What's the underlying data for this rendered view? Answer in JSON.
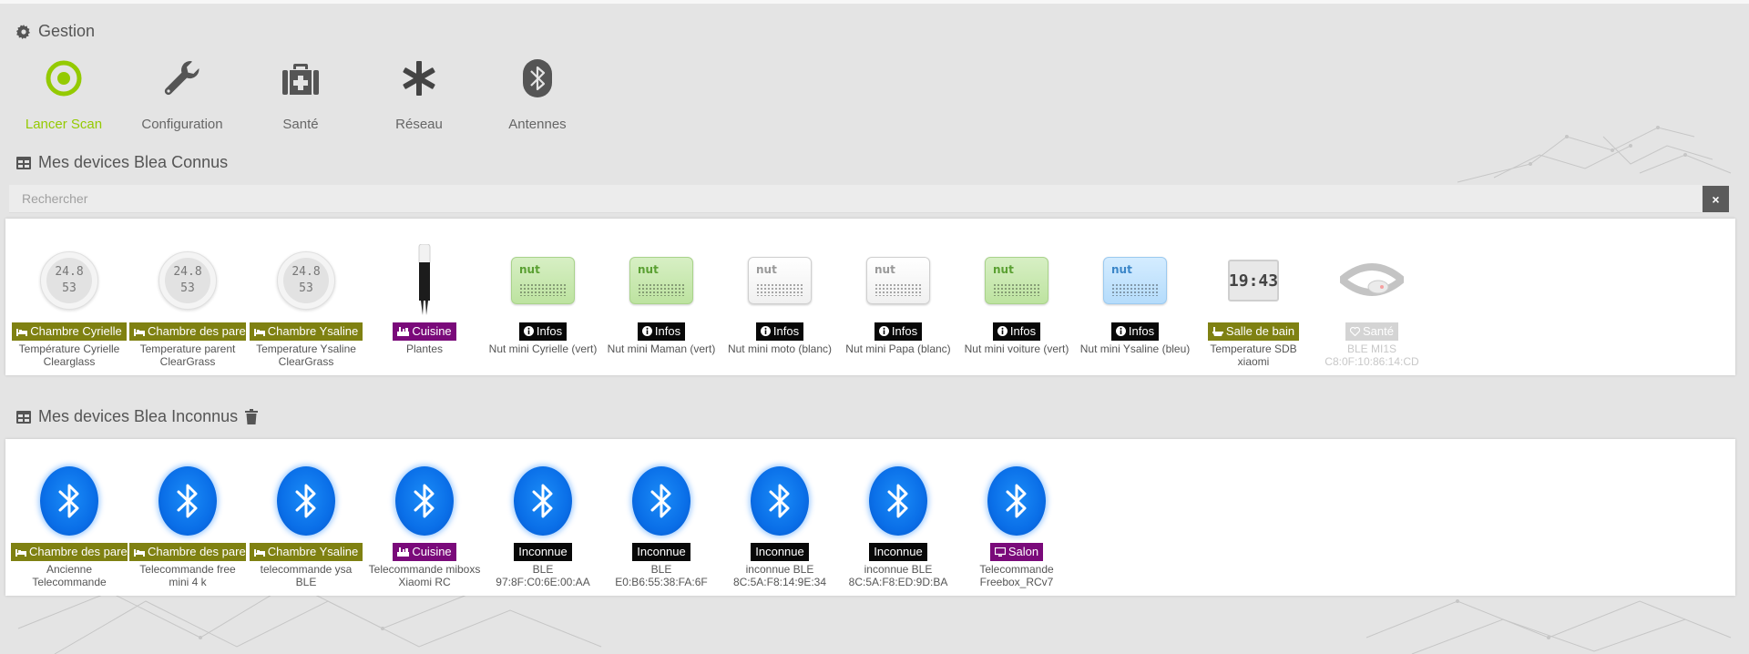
{
  "gestion": {
    "title": "Gestion",
    "items": [
      {
        "label": "Lancer Scan",
        "icon": "scan-target-icon"
      },
      {
        "label": "Configuration",
        "icon": "wrench-icon"
      },
      {
        "label": "Santé",
        "icon": "medkit-icon"
      },
      {
        "label": "Réseau",
        "icon": "asterisk-icon"
      },
      {
        "label": "Antennes",
        "icon": "bluetooth-icon"
      }
    ]
  },
  "known": {
    "title": "Mes devices Blea Connus",
    "search_placeholder": "Rechercher",
    "clear_label": "×",
    "devices": [
      {
        "badge": "Chambre Cyrielle",
        "badge_icon": "bed-icon",
        "name": "Température Cyrielle Clearglass",
        "image": "thermometer-clock"
      },
      {
        "badge": "Chambre des parents",
        "badge_icon": "bed-icon",
        "name": "Temperature parent ClearGrass",
        "image": "thermometer-clock"
      },
      {
        "badge": "Chambre Ysaline",
        "badge_icon": "bed-icon",
        "name": "Temperature Ysaline ClearGrass",
        "image": "thermometer-clock"
      },
      {
        "badge": "Cuisine",
        "badge_icon": "kitchen-icon",
        "name": "Plantes",
        "image": "plant-sensor"
      },
      {
        "badge": "Infos",
        "badge_icon": "info-icon",
        "name": "Nut mini Cyrielle (vert)",
        "image": "nut-green"
      },
      {
        "badge": "Infos",
        "badge_icon": "info-icon",
        "name": "Nut mini Maman (vert)",
        "image": "nut-green"
      },
      {
        "badge": "Infos",
        "badge_icon": "info-icon",
        "name": "Nut mini moto (blanc)",
        "image": "nut-white"
      },
      {
        "badge": "Infos",
        "badge_icon": "info-icon",
        "name": "Nut mini Papa (blanc)",
        "image": "nut-white"
      },
      {
        "badge": "Infos",
        "badge_icon": "info-icon",
        "name": "Nut mini voiture (vert)",
        "image": "nut-green"
      },
      {
        "badge": "Infos",
        "badge_icon": "info-icon",
        "name": "Nut mini Ysaline (bleu)",
        "image": "nut-blue"
      },
      {
        "badge": "Salle de bain",
        "badge_icon": "bath-icon",
        "name": "Temperature SDB xiaomi",
        "image": "lcd-clock"
      },
      {
        "badge": "Santé",
        "badge_icon": "heart-icon",
        "name": "BLE MI1S C8:0F:10:86:14:CD",
        "image": "mi-band"
      }
    ],
    "clock_top": "24.8",
    "clock_bottom": "53",
    "lcd_text": "19:43"
  },
  "unknown": {
    "title": "Mes devices Blea Inconnus",
    "devices": [
      {
        "badge": "Chambre des parents",
        "badge_icon": "bed-icon",
        "name": "Ancienne Telecommande"
      },
      {
        "badge": "Chambre des parents",
        "badge_icon": "bed-icon",
        "name": "Telecommande free mini 4 k"
      },
      {
        "badge": "Chambre Ysaline",
        "badge_icon": "bed-icon",
        "name": "telecommande ysa BLE"
      },
      {
        "badge": "Cuisine",
        "badge_icon": "kitchen-icon",
        "name": "Telecommande miboxs Xiaomi RC"
      },
      {
        "badge": "Inconnue",
        "badge_icon": "",
        "name": "BLE 97:8F:C0:6E:00:AA"
      },
      {
        "badge": "Inconnue",
        "badge_icon": "",
        "name": "BLE E0:B6:55:38:FA:6F"
      },
      {
        "badge": "Inconnue",
        "badge_icon": "",
        "name": "inconnue BLE 8C:5A:F8:14:9E:34"
      },
      {
        "badge": "Inconnue",
        "badge_icon": "",
        "name": "inconnue BLE 8C:5A:F8:ED:9D:BA"
      },
      {
        "badge": "Salon",
        "badge_icon": "monitor-icon",
        "name": "Telecommande Freebox_RCv7"
      }
    ]
  },
  "colors": {
    "accent_green": "#94ca02",
    "badge_olive": "#7f8112",
    "badge_purple": "#7a0a7a",
    "badge_black": "#080808",
    "badge_disabled": "#d4d4d4",
    "bluetooth_blue": "#0a6fe8"
  }
}
